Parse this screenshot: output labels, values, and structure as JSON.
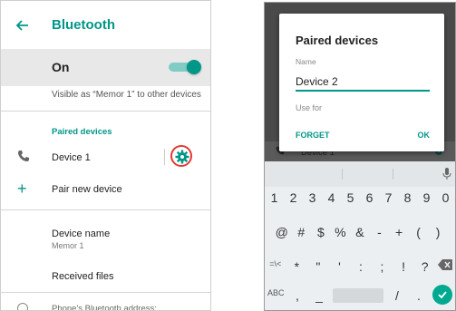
{
  "left": {
    "title": "Bluetooth",
    "toggle_label": "On",
    "visible_text": "Visible as “Memor 1” to other devices",
    "paired_header": "Paired devices",
    "device1": "Device 1",
    "pair_new": "Pair new device",
    "device_name_label": "Device name",
    "device_name_value": "Memor 1",
    "received_files": "Received files",
    "address_label": "Phone's Bluetooth address:"
  },
  "right": {
    "behind_device": "Device 1",
    "dialog": {
      "title": "Paired devices",
      "name_label": "Name",
      "name_value": "Device 2",
      "use_for": "Use for",
      "forget": "FORGET",
      "ok": "OK"
    },
    "keyboard": {
      "row1": [
        "1",
        "2",
        "3",
        "4",
        "5",
        "6",
        "7",
        "8",
        "9",
        "0"
      ],
      "row2": [
        "@",
        "#",
        "$",
        "%",
        "&",
        "-",
        "+",
        "(",
        ")"
      ],
      "row3": [
        "=\\<",
        "*",
        "\"",
        "'",
        ":",
        ";",
        "!",
        "?"
      ],
      "row4_left": "ABC",
      "row4_keys": [
        ",",
        "_",
        "/",
        "."
      ]
    }
  },
  "colors": {
    "accent": "#009688",
    "highlight": "#e53935"
  }
}
